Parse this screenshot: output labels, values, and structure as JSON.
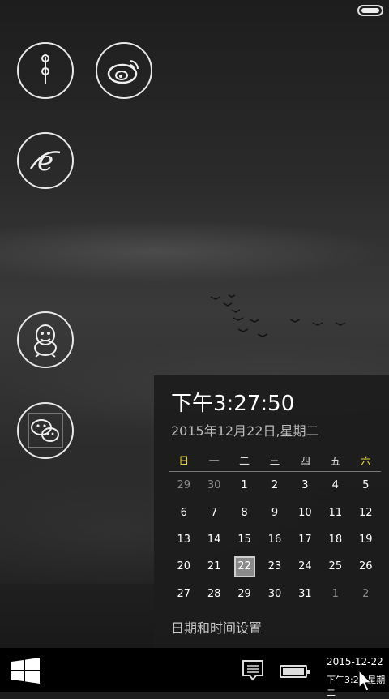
{
  "status": {
    "toggle_icon": "toggle-icon"
  },
  "tiles": [
    {
      "name": "scissors-app",
      "icon": "app-icon"
    },
    {
      "name": "weibo-app",
      "icon": "weibo-icon"
    },
    {
      "name": "ie-browser",
      "icon": "ie-icon"
    },
    {
      "name": "qq-app",
      "icon": "qq-icon"
    },
    {
      "name": "wechat-app",
      "icon": "wechat-icon"
    }
  ],
  "calendar": {
    "time": "下午3:27:50",
    "date": "2015年12月22日,星期二",
    "weekdays": [
      "日",
      "一",
      "二",
      "三",
      "四",
      "五",
      "六"
    ],
    "weeks": [
      [
        "29",
        "30",
        "1",
        "2",
        "3",
        "4",
        "5"
      ],
      [
        "6",
        "7",
        "8",
        "9",
        "10",
        "11",
        "12"
      ],
      [
        "13",
        "14",
        "15",
        "16",
        "17",
        "18",
        "19"
      ],
      [
        "20",
        "21",
        "22",
        "23",
        "24",
        "25",
        "26"
      ],
      [
        "27",
        "28",
        "29",
        "30",
        "31",
        "1",
        "2"
      ]
    ],
    "today": "22",
    "settings_link": "日期和时间设置",
    "weekend_color": "#e6d33a"
  },
  "taskbar": {
    "clock_date": "2015-12-22",
    "clock_time": "下午3:27 星期二"
  }
}
